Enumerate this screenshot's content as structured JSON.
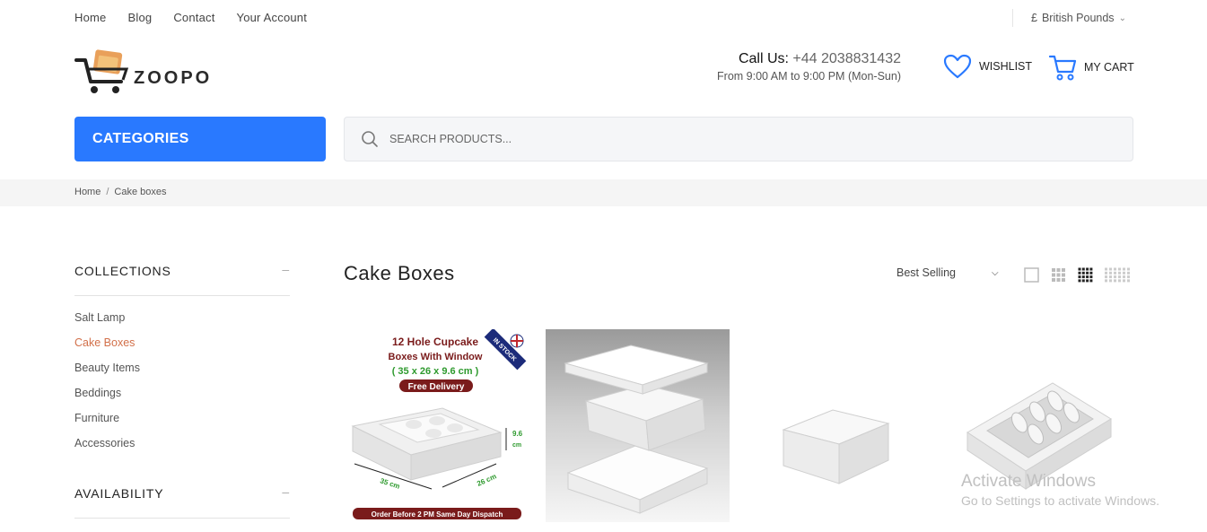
{
  "topnav": {
    "items": [
      "Home",
      "Blog",
      "Contact",
      "Your Account"
    ]
  },
  "currency": {
    "symbol": "£",
    "label": "British Pounds"
  },
  "brand": {
    "name": "ZOOPO"
  },
  "contact": {
    "call_label": "Call Us:",
    "phone": "+44 2038831432",
    "hours": "From 9:00 AM to 9:00 PM (Mon-Sun)"
  },
  "header": {
    "wishlist": "WISHLIST",
    "cart": "MY CART"
  },
  "categories": {
    "label": "CATEGORIES"
  },
  "search": {
    "placeholder": "SEARCH PRODUCTS..."
  },
  "breadcrumb": {
    "items": [
      "Home",
      "Cake boxes"
    ]
  },
  "sidebar": {
    "collections_title": "COLLECTIONS",
    "collections": [
      "Salt Lamp",
      "Cake Boxes",
      "Beauty Items",
      "Beddings",
      "Furniture",
      "Accessories"
    ],
    "active_collection": "Cake Boxes",
    "availability_title": "AVAILABILITY",
    "collapse_symbol": "–"
  },
  "main": {
    "title": "Cake Boxes",
    "sort": {
      "selected": "Best Selling"
    },
    "grid_views": [
      "grid-1-icon",
      "grid-3-icon",
      "grid-4-icon",
      "grid-6-icon"
    ]
  },
  "products": [
    {
      "image_texts": {
        "title_line1": "12 Hole Cupcake",
        "title_line2": "Boxes With Window",
        "dims": "( 35 x 26 x 9.6 cm )",
        "delivery": "Free Delivery",
        "stock": "IN STOCK",
        "height": "9.6",
        "height_unit": "cm",
        "length": "35 cm",
        "width": "26 cm",
        "dispatch": "Order Before 2 PM Same Day Dispatch"
      }
    },
    {
      "image": "stacked-white-cake-boxes"
    },
    {
      "image": "small-white-cake-box"
    },
    {
      "image": "cupcake-box-with-window"
    }
  ],
  "watermark": {
    "line1": "Activate Windows",
    "line2": "Go to Settings to activate Windows."
  },
  "colors": {
    "accent": "#2979ff",
    "active_link": "#d2704a",
    "text": "#222222"
  }
}
